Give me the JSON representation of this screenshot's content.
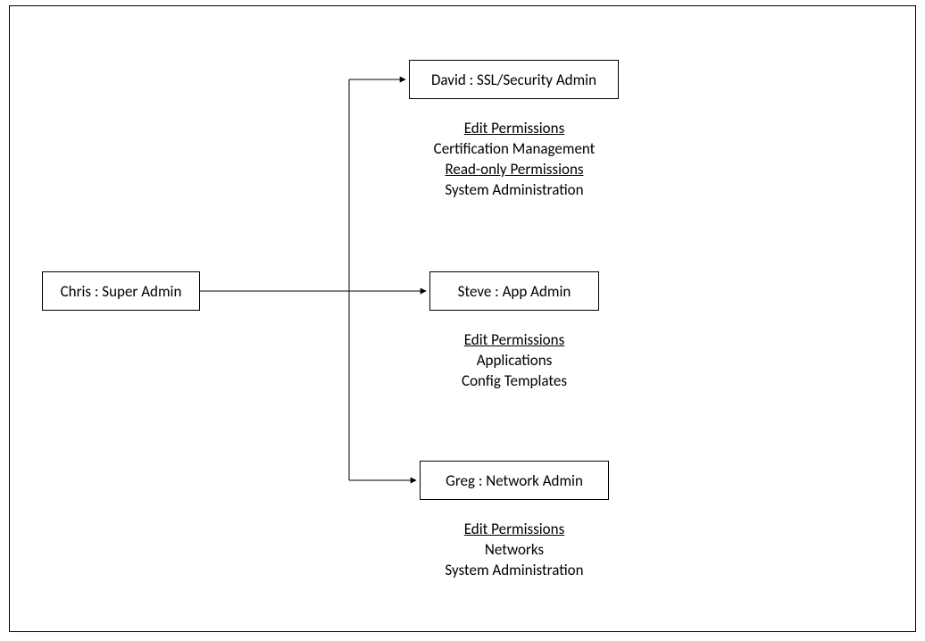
{
  "root": {
    "label": "Chris : Super Admin"
  },
  "children": [
    {
      "label": "David : SSL/Security Admin",
      "permissions": [
        {
          "header": "Edit Permissions",
          "items": [
            "Certification Management"
          ]
        },
        {
          "header": "Read-only Permissions",
          "items": [
            "System Administration"
          ]
        }
      ]
    },
    {
      "label": "Steve : App Admin",
      "permissions": [
        {
          "header": "Edit Permissions",
          "items": [
            "Applications",
            "Config Templates"
          ]
        }
      ]
    },
    {
      "label": "Greg : Network Admin",
      "permissions": [
        {
          "header": "Edit Permissions",
          "items": [
            "Networks",
            "System Administration"
          ]
        }
      ]
    }
  ]
}
